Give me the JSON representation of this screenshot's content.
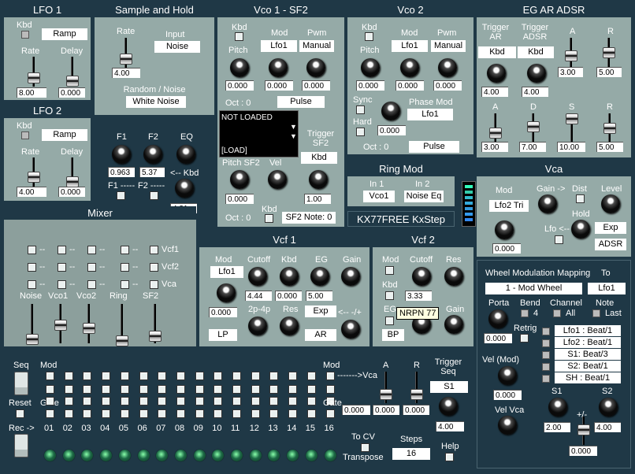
{
  "lfo1": {
    "title": "LFO 1",
    "kbd": "Kbd",
    "wave": "Ramp",
    "rate": "Rate",
    "delay": "Delay",
    "rate_val": "8.00",
    "delay_val": "0.000"
  },
  "lfo2": {
    "title": "LFO 2",
    "kbd": "Kbd",
    "wave": "Ramp",
    "rate": "Rate",
    "delay": "Delay",
    "rate_val": "4.00",
    "delay_val": "0.000"
  },
  "sh": {
    "title": "Sample and Hold",
    "rate": "Rate",
    "input": "Input",
    "input_val": "Noise",
    "rate_val": "4.00",
    "random": "Random / Noise",
    "random_val": "White Noise"
  },
  "eq": {
    "f1": "F1",
    "f2": "F2",
    "eq": "EQ",
    "f1_val": "0.963",
    "f2_val": "5.37",
    "kbd": "<-- Kbd",
    "f1_lbl": "F1 -----",
    "f2_lbl": "F2 -----",
    "eq_val": "4.31"
  },
  "vco1": {
    "title": "Vco 1 - SF2",
    "kbd": "Kbd",
    "mod": "Mod",
    "pwm": "Pwm",
    "pitch": "Pitch",
    "mod_val": "Lfo1",
    "pwm_val": "Manual",
    "v1": "0.000",
    "v2": "0.000",
    "v3": "0.000",
    "oct": "Oct : 0",
    "wave": "Pulse",
    "sf_line1": "NOT LOADED",
    "sf_line2": "[LOAD]",
    "trig": "Trigger SF2",
    "trig_val": "Kbd",
    "pitch_sf2": "Pitch SF2",
    "vel": "Vel",
    "psf_val": "0.000",
    "vel_val": "1.00",
    "oct2": "Oct : 0",
    "kbd2": "Kbd",
    "note": "SF2 Note: 0"
  },
  "vco2": {
    "title": "Vco 2",
    "kbd": "Kbd",
    "mod": "Mod",
    "pwm": "Pwm",
    "pitch": "Pitch",
    "mod_val": "Lfo1",
    "pwm_val": "Manual",
    "v1": "0.000",
    "v2": "0.000",
    "v3": "0.000",
    "sync": "Sync",
    "phase": "Phase Mod",
    "phase_val": "Lfo1",
    "hard": "Hard",
    "hard_val": "0.000",
    "oct": "Oct : 0",
    "wave": "Pulse"
  },
  "ring": {
    "title": "Ring Mod",
    "in1": "In 1",
    "in2": "In 2",
    "in1_val": "Vco1",
    "in2_val": "Noise Eq"
  },
  "brand": "KX77FREE KxStep",
  "eg": {
    "title": "EG AR ADSR",
    "trig_ar": "Trigger AR",
    "trig_adsr": "Trigger ADSR",
    "a": "A",
    "r": "R",
    "ar_val": "Kbd",
    "adsr_val": "Kbd",
    "a_val": "3.00",
    "r_val": "5.00",
    "k1": "4.00",
    "k2": "4.00",
    "a2": "A",
    "d": "D",
    "s": "S",
    "r2": "R",
    "a2_val": "3.00",
    "d_val": "7.00",
    "s_val": "10.00",
    "r2_val": "5.00"
  },
  "vca": {
    "title": "Vca",
    "mod": "Mod",
    "gain": "Gain ->",
    "dist": "Dist",
    "level": "Level",
    "mod_val": "Lfo2 Tri",
    "hold": "Hold",
    "lfo": "Lfo <--",
    "exp": "Exp",
    "adsr": "ADSR",
    "mod_num": "0.000"
  },
  "mixer": {
    "title": "Mixer",
    "dash": "--",
    "row_labels": [
      "Vcf1",
      "Vcf2",
      "Vca"
    ],
    "faders": [
      "Noise",
      "Vco1",
      "Vco2",
      "Ring",
      "SF2"
    ]
  },
  "vcf1": {
    "title": "Vcf 1",
    "mod": "Mod",
    "cutoff": "Cutoff",
    "kbd": "Kbd",
    "eg": "EG",
    "gain": "Gain",
    "mod_val": "Lfo1",
    "cut_val": "4.44",
    "kbd_val": "0.000",
    "eg_val": "5.00",
    "modn": "0.000",
    "pole": "2p-4p",
    "res": "Res",
    "exp": "Exp",
    "inv": "<-- -/+",
    "lp": "LP",
    "ar": "AR"
  },
  "vcf2": {
    "title": "Vcf 2",
    "mod": "Mod",
    "cutoff": "Cutoff",
    "res": "Res",
    "kbd": "Kbd",
    "cut_val": "3.33",
    "eg": "EG",
    "tooltip": "NRPN 77",
    "gain": "Gain",
    "bp": "BP"
  },
  "seq": {
    "seq": "Seq",
    "mod": "Mod",
    "gate": "Gate",
    "reset": "Reset",
    "rec": "Rec ->",
    "mod_r": "Mod",
    "gate_r": "Gate",
    "to_vca": "------->Vca",
    "a": "A",
    "r": "R",
    "trig": "Trigger Seq",
    "trig_val": "S1",
    "v1": "0.000",
    "v2": "0.000",
    "v3": "0.000",
    "tempo": "4.00",
    "tocv": "To CV",
    "transpose": "Transpose",
    "steps": "Steps",
    "steps_val": "16",
    "help": "Help",
    "nums": [
      "01",
      "02",
      "03",
      "04",
      "05",
      "06",
      "07",
      "08",
      "09",
      "10",
      "11",
      "12",
      "13",
      "14",
      "15",
      "16"
    ]
  },
  "wheel": {
    "title": "Wheel Modulation Mapping",
    "to": "To",
    "src": "1 - Mod Wheel",
    "dst": "Lfo1",
    "porta": "Porta",
    "bend": "Bend",
    "bend_val": "4",
    "channel": "Channel",
    "all": "All",
    "note": "Note",
    "last": "Last",
    "retrig": "Retrig",
    "porta_val": "0.000",
    "beats": [
      "Lfo1 : Beat/1",
      "Lfo2 : Beat/1",
      "S1: Beat/3",
      "S2: Beat/1",
      "SH : Beat/1"
    ],
    "velmod": "Vel (Mod)",
    "velmod_val": "0.000",
    "velvca": "Vel Vca",
    "s1": "S1",
    "s2": "S2",
    "s1_val": "2.00",
    "s2_val": "4.00",
    "pm": "+/-",
    "pm_val": "0.000"
  }
}
